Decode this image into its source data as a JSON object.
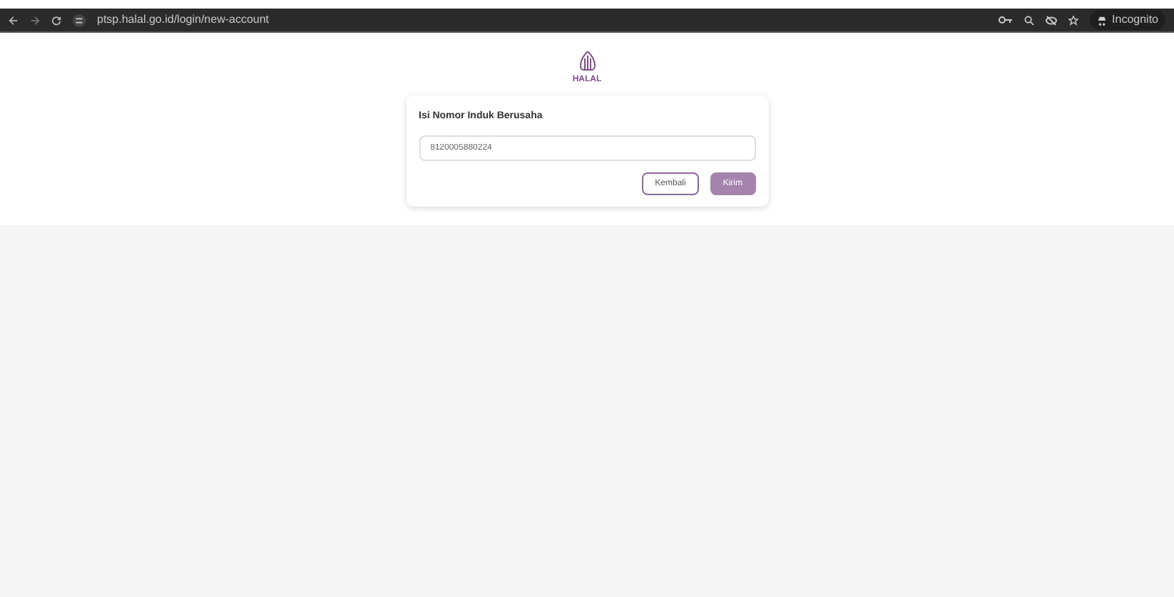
{
  "browser": {
    "url": "ptsp.halal.go.id/login/new-account",
    "profile": "Incognito"
  },
  "logo": {
    "text": "HALAL"
  },
  "form": {
    "title": "Isi Nomor Induk Berusaha",
    "value": "8120005880224",
    "buttons": [
      {
        "label": "Kembali",
        "kind": "outline"
      },
      {
        "label": "Kirim",
        "kind": "primary"
      }
    ]
  }
}
